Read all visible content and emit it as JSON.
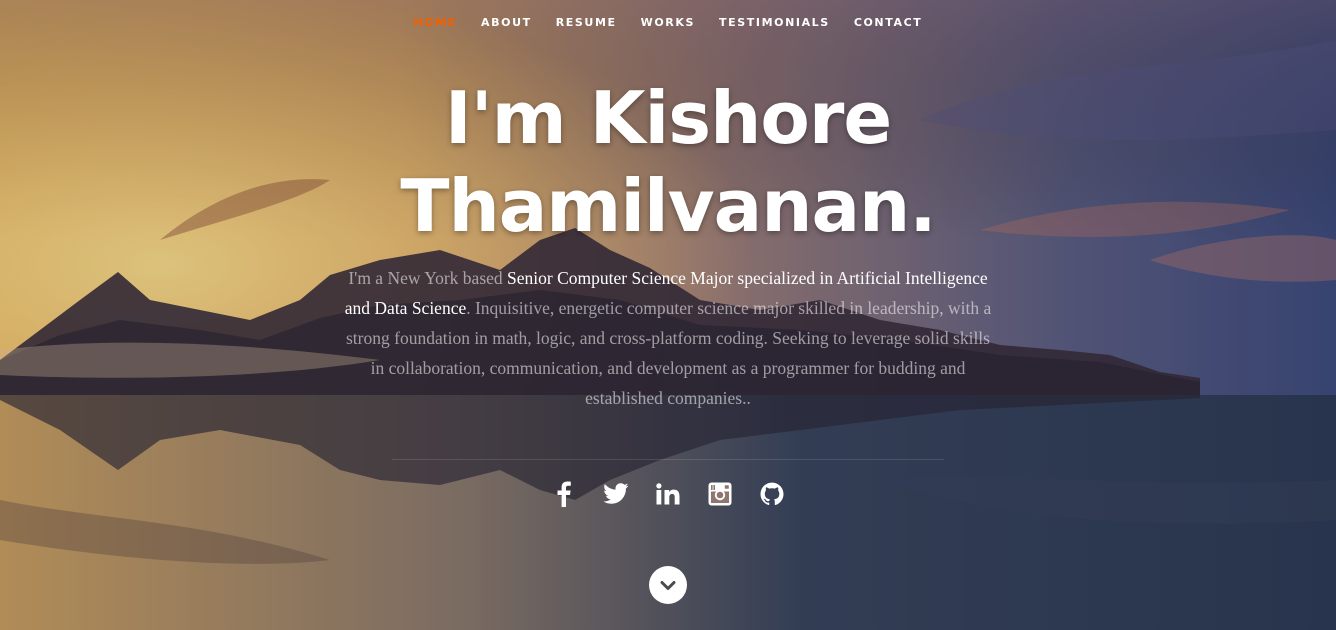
{
  "nav": {
    "items": [
      {
        "label": "HOME",
        "active": true
      },
      {
        "label": "ABOUT",
        "active": false
      },
      {
        "label": "RESUME",
        "active": false
      },
      {
        "label": "WORKS",
        "active": false
      },
      {
        "label": "TESTIMONIALS",
        "active": false
      },
      {
        "label": "CONTACT",
        "active": false
      }
    ],
    "active_color": "#f06000"
  },
  "headline": {
    "line1": "I'm Kishore",
    "line2": "Thamilvanan."
  },
  "bio": {
    "intro": "I'm a New York based ",
    "highlight": "Senior Computer Science Major specialized in Artificial Intelligence and Data Science",
    "rest": ". Inquisitive, energetic computer science major skilled in leadership, with a strong foundation in math, logic, and cross-platform coding. Seeking to leverage solid skills in collaboration, communication, and development as a programmer for budding and established companies.."
  },
  "social": [
    {
      "name": "facebook",
      "icon": "facebook-icon"
    },
    {
      "name": "twitter",
      "icon": "twitter-icon"
    },
    {
      "name": "linkedin",
      "icon": "linkedin-icon"
    },
    {
      "name": "instagram",
      "icon": "instagram-icon"
    },
    {
      "name": "github",
      "icon": "github-icon"
    }
  ],
  "scroll_down": {
    "icon": "chevron-down-icon"
  }
}
